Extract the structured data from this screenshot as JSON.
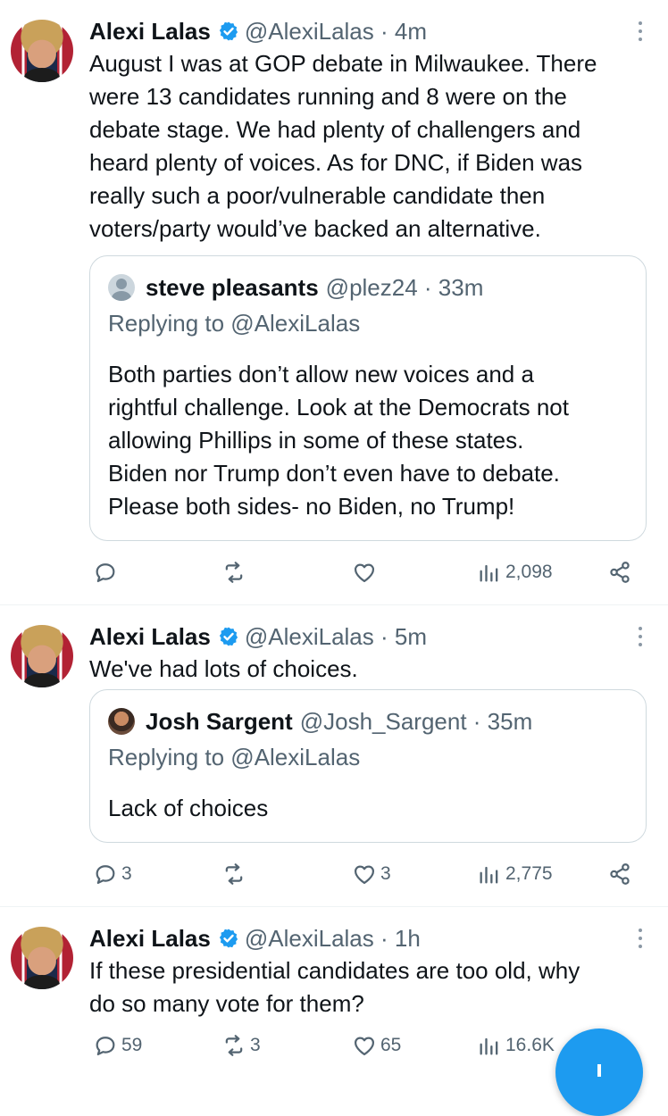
{
  "tweets": [
    {
      "author_name": "Alexi Lalas",
      "handle": "@AlexiLalas",
      "time": "4m",
      "text": "August I was at GOP debate in Milwaukee. There\nwere 13 candidates running and 8 were on the\ndebate stage. We had plenty of challengers and\nheard plenty of voices. As for DNC, if Biden was\nreally such a poor/vulnerable candidate then\nvoters/party would’ve backed an alternative.",
      "quote": {
        "author_name": "steve pleasants",
        "handle": "@plez24",
        "time": "33m",
        "replying_to": "Replying to @AlexiLalas",
        "text": "Both parties don’t allow new voices and a\nrightful challenge. Look at the Democrats not\nallowing Phillips in some of these states.\nBiden nor Trump don’t even have to debate.\nPlease both sides- no Biden, no Trump!"
      },
      "replies": "",
      "retweets": "",
      "likes": "",
      "views": "2,098"
    },
    {
      "author_name": "Alexi Lalas",
      "handle": "@AlexiLalas",
      "time": "5m",
      "text": "We've had lots of choices.",
      "quote": {
        "author_name": "Josh Sargent",
        "handle": "@Josh_Sargent",
        "time": "35m",
        "replying_to": "Replying to @AlexiLalas",
        "text": "Lack of choices"
      },
      "replies": "3",
      "retweets": "",
      "likes": "3",
      "views": "2,775"
    },
    {
      "author_name": "Alexi Lalas",
      "handle": "@AlexiLalas",
      "time": "1h",
      "text": "If these presidential candidates are too old, why\ndo so many vote for them?",
      "replies": "59",
      "retweets": "3",
      "likes": "65",
      "views": "16.6K"
    }
  ],
  "separator": " · ",
  "icons": {
    "verified": "verified-badge-icon",
    "more": "more-vertical-icon",
    "reply": "reply-icon",
    "retweet": "retweet-icon",
    "like": "heart-icon",
    "views": "views-chart-icon",
    "share": "share-icon",
    "compose": "compose-plus-icon"
  },
  "colors": {
    "accent": "#1d9bf0",
    "text": "#0f1419",
    "secondary": "#536471",
    "border": "#cfd9de"
  }
}
